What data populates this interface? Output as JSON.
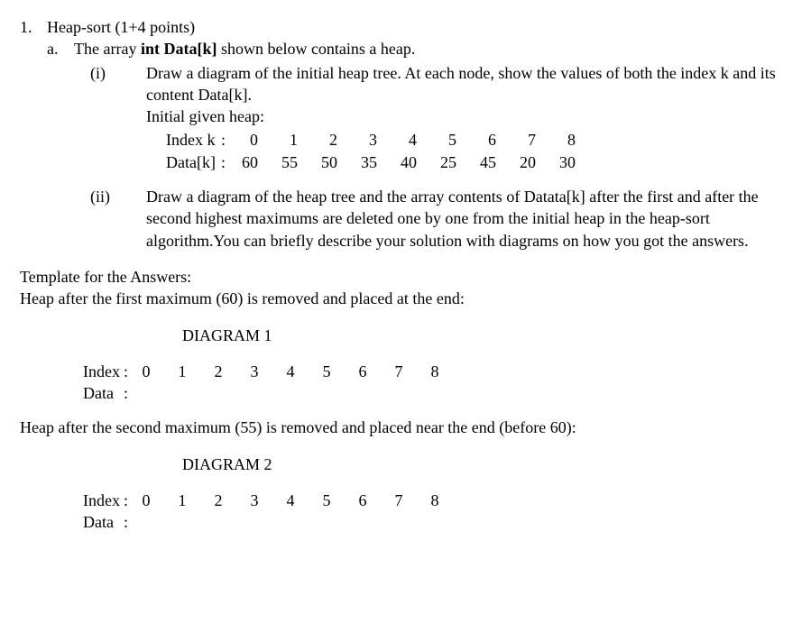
{
  "q1": {
    "number": "1.",
    "title": "Heap-sort (1+4  points)",
    "a": {
      "label": "a.",
      "intro_before_bold": "The array ",
      "intro_bold": "int Data[k]",
      "intro_after_bold": " shown below contains a heap.",
      "i": {
        "label": "(i)",
        "text": "Draw a diagram of the initial heap tree. At each node, show the values of both the index k and its content Data[k].",
        "initial_line": "Initial given heap:",
        "table": {
          "row_index_label": "Index k",
          "row_data_label": "Data[k]",
          "colon": ":",
          "indices": [
            "0",
            "1",
            "2",
            "3",
            "4",
            "5",
            "6",
            "7",
            "8"
          ],
          "values": [
            "60",
            "55",
            "50",
            "35",
            "40",
            "25",
            "45",
            "20",
            "30"
          ]
        }
      },
      "ii": {
        "label": "(ii)",
        "text": "Draw a diagram of the heap tree and the array contents of Datata[k] after  the first and  after the second highest maximums are deleted one by one from the initial heap in the heap-sort algorithm.You can briefly describe your solution with diagrams on how you got the answers."
      }
    }
  },
  "template": {
    "header": "Template for the Answers:",
    "first": {
      "line": "Heap after the first maximum (60) is removed and placed at the end:",
      "diagram": "DIAGRAM 1",
      "row_index_label": "Index",
      "row_data_label": "Data",
      "colon": ":",
      "indices": [
        "0",
        "1",
        "2",
        "3",
        "4",
        "5",
        "6",
        "7",
        "8"
      ]
    },
    "second": {
      "line": "Heap after the second maximum (55) is removed and placed near the end (before 60):",
      "diagram": "DIAGRAM 2",
      "row_index_label": "Index",
      "row_data_label": "Data",
      "colon": ":",
      "indices": [
        "0",
        "1",
        "2",
        "3",
        "4",
        "5",
        "6",
        "7",
        "8"
      ]
    }
  }
}
